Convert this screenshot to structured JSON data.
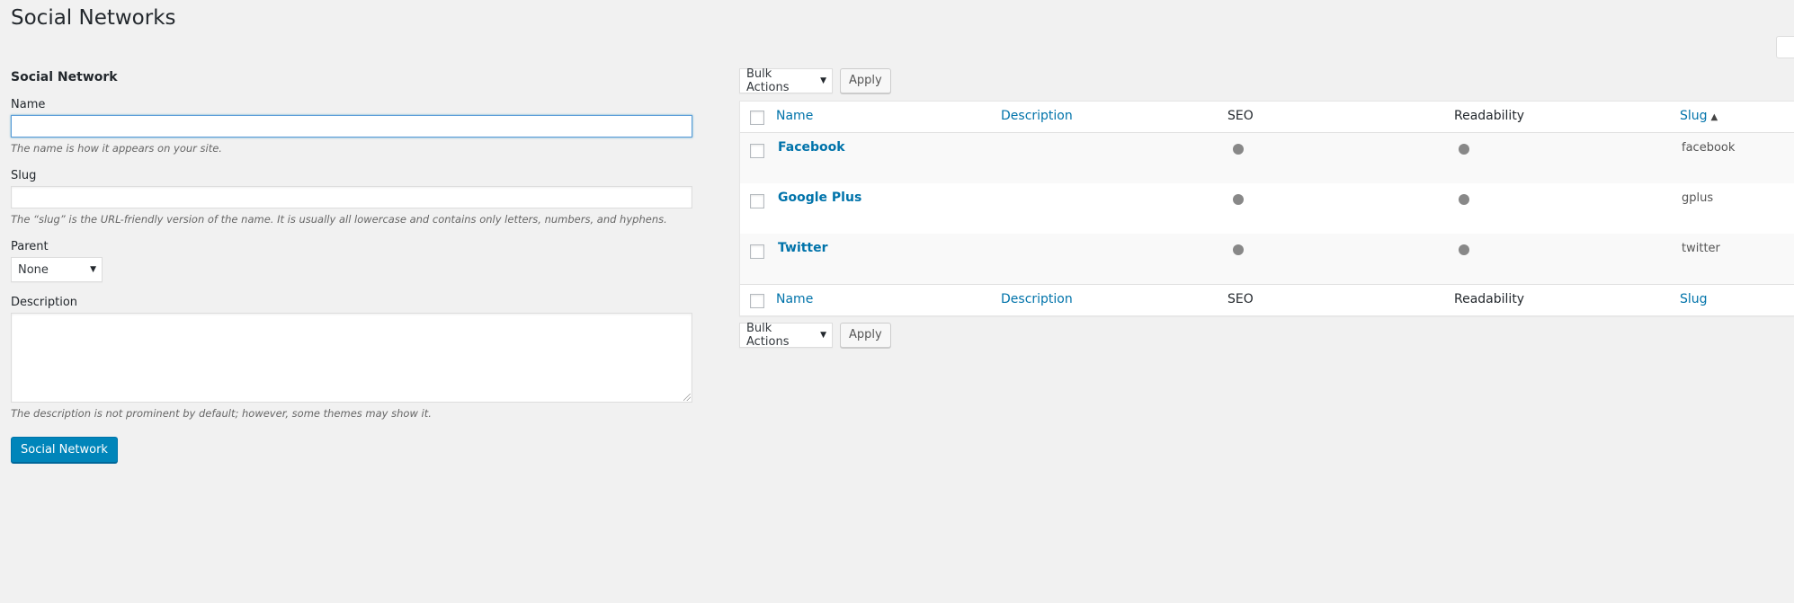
{
  "page": {
    "title": "Social Networks"
  },
  "form": {
    "heading": "Social Network",
    "name": {
      "label": "Name",
      "value": "",
      "help": "The name is how it appears on your site."
    },
    "slug": {
      "label": "Slug",
      "value": "",
      "help": "The “slug” is the URL-friendly version of the name. It is usually all lowercase and contains only letters, numbers, and hyphens."
    },
    "parent": {
      "label": "Parent",
      "selected": "None"
    },
    "description": {
      "label": "Description",
      "value": "",
      "help": "The description is not prominent by default; however, some themes may show it."
    },
    "submit_label": "Social Network"
  },
  "tablenav": {
    "top": {
      "bulk_label": "Bulk Actions",
      "apply_label": "Apply"
    },
    "bottom": {
      "bulk_label": "Bulk Actions",
      "apply_label": "Apply"
    }
  },
  "table": {
    "columns": {
      "name": "Name",
      "description": "Description",
      "seo": "SEO",
      "readability": "Readability",
      "slug": "Slug"
    },
    "rows": [
      {
        "name": "Facebook",
        "slug": "facebook",
        "seo_icon": "circle-icon",
        "readability_icon": "circle-icon"
      },
      {
        "name": "Google Plus",
        "slug": "gplus",
        "seo_icon": "circle-icon",
        "readability_icon": "circle-icon"
      },
      {
        "name": "Twitter",
        "slug": "twitter",
        "seo_icon": "circle-icon",
        "readability_icon": "circle-icon"
      }
    ]
  },
  "colors": {
    "accent": "#0073aa",
    "primary_button": "#0085ba",
    "status_dot": "#888888",
    "background": "#f1f1f1"
  }
}
